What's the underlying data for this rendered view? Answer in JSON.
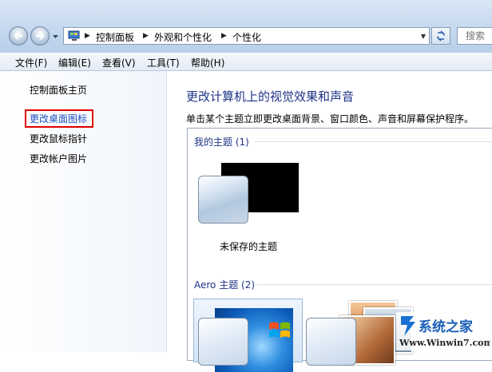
{
  "address": {
    "crumbs": [
      "控制面板",
      "外观和个性化",
      "个性化"
    ]
  },
  "search": {
    "placeholder": "搜索"
  },
  "menu": [
    "文件(F)",
    "编辑(E)",
    "查看(V)",
    "工具(T)",
    "帮助(H)"
  ],
  "tasks": [
    "控制面板主页",
    "更改桌面图标",
    "更改鼠标指针",
    "更改帐户图片"
  ],
  "main": {
    "title": "更改计算机上的视觉效果和声音",
    "description": "单击某个主题立即更改桌面背景、窗口颜色、声音和屏幕保护程序。",
    "groups": {
      "mine": "我的主题 (1)",
      "aero": "Aero 主题 (2)"
    },
    "unsaved_theme": "未保存的主题"
  },
  "watermark": {
    "brand": "系统之家",
    "url": "Www.Winwin7.com"
  },
  "colors": {
    "title_blue": "#1e3287",
    "highlight_red": "#e00000",
    "link_blue": "#1f4fbf"
  },
  "icons": [
    "back-arrow-icon",
    "forward-arrow-icon",
    "control-panel-icon",
    "refresh-icon",
    "windows-logo-icon"
  ]
}
